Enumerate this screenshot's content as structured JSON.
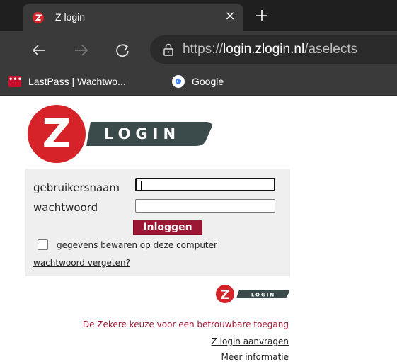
{
  "browser": {
    "tab_title": "Z login",
    "tab_close_icon": "close-icon",
    "new_tab_icon": "plus-icon",
    "url_scheme": "https://",
    "url_host": "login.zlogin.nl",
    "url_path": "/aselects",
    "bookmarks": [
      {
        "label": "LastPass | Wachtwo...",
        "icon": "lastpass-icon"
      },
      {
        "label": "Google",
        "icon": "google-icon"
      }
    ]
  },
  "logo": {
    "letter": "Z",
    "text": "LOGIN"
  },
  "form": {
    "username_label": "gebruikersnaam",
    "username_value": "",
    "password_label": "wachtwoord",
    "password_value": "",
    "login_button": "Inloggen",
    "remember_label": "gegevens bewaren op deze computer",
    "forgot_link": "wachtwoord vergeten?"
  },
  "footer": {
    "logo_text": "LOGIN",
    "tagline": "De Zekere keuze voor een betrouwbare toegang",
    "links": [
      "Z login aanvragen",
      "Meer informatie"
    ]
  },
  "colors": {
    "brand_red": "#d6232a",
    "brand_dark": "#3b4a4b",
    "button_red": "#9c1733",
    "chrome_dark": "#1f1f1f",
    "chrome_mid": "#3a3a3a"
  }
}
